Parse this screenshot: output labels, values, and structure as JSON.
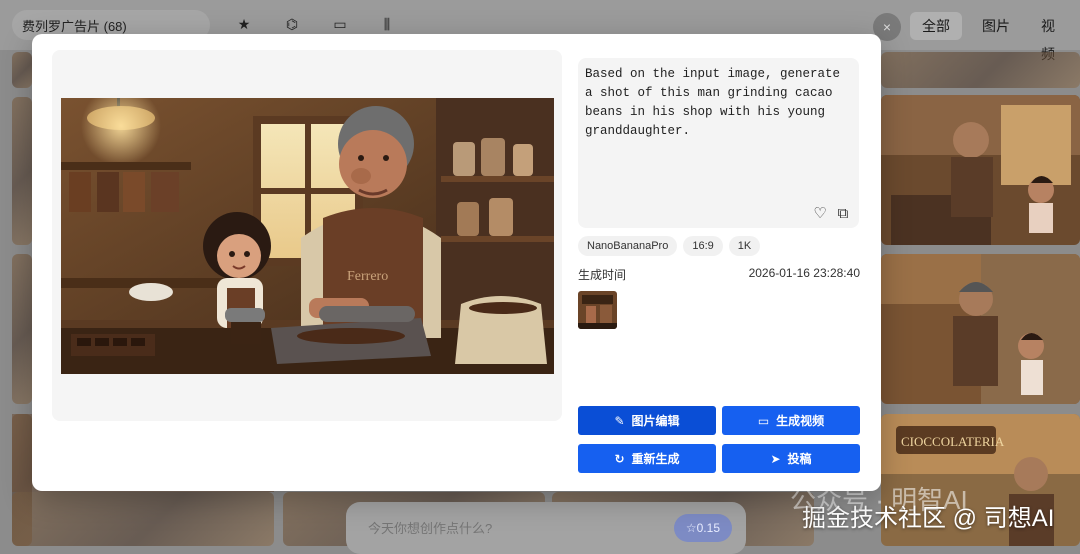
{
  "background": {
    "album_select": "费列罗广告片 (68)",
    "tool_icons": [
      "star-icon",
      "share-icon",
      "folder-move-icon",
      "sliders-icon"
    ],
    "close_icon": "×",
    "filter_tabs": [
      {
        "label": "全部",
        "active": true
      },
      {
        "label": "图片",
        "active": false
      },
      {
        "label": "视频",
        "active": false
      }
    ],
    "prompt_placeholder": "今天你想创作点什么?",
    "credit_label": "☆0.15",
    "watermark_1": "公众号 · 明智AI",
    "watermark_2": "掘金技术社区 @ 司想AI"
  },
  "modal": {
    "prompt": "Based on the input image, generate a shot of this man grinding cacao beans in his shop with his young granddaughter.",
    "tags": [
      "NanoBananaPro",
      "16:9",
      "1K"
    ],
    "generated_time_label": "生成时间",
    "generated_time_value": "2026-01-16 23:28:40",
    "image_text": "Ferrero",
    "buttons": {
      "edit_image": "图片编辑",
      "generate_video": "生成视频",
      "regenerate": "重新生成",
      "submit": "投稿"
    },
    "colors": {
      "primary_button": "#0a4ed6",
      "accent_button": "#1660f0"
    }
  }
}
